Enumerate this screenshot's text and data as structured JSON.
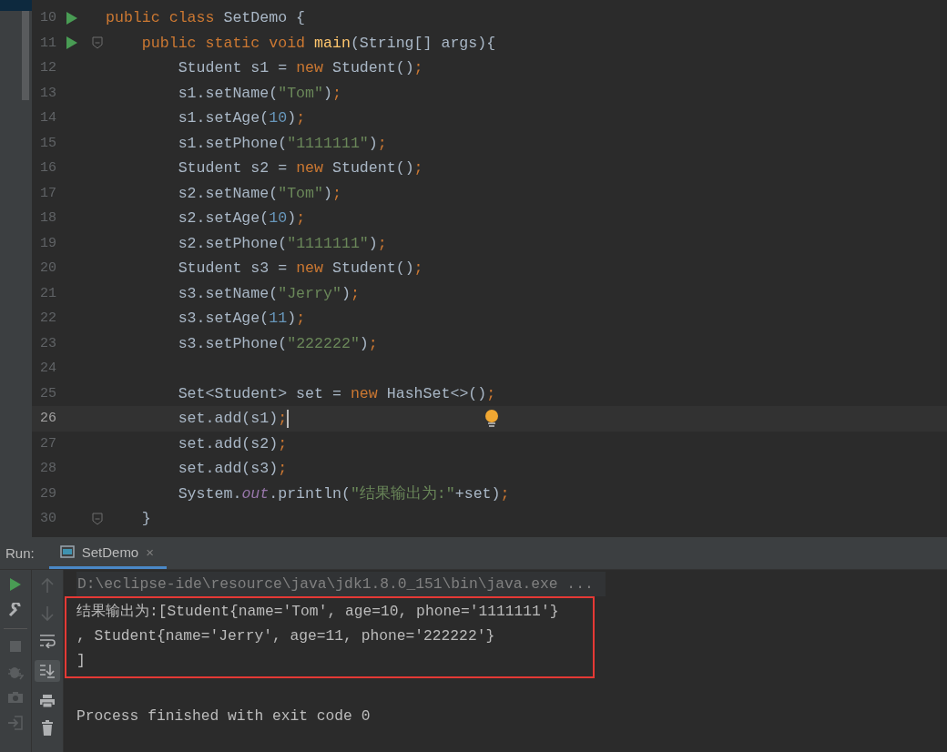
{
  "editor": {
    "lines": [
      {
        "number": "10",
        "run": true,
        "fold": false,
        "current": false,
        "hint": false,
        "tokens": [
          {
            "text": "public class ",
            "kind": "kw"
          },
          {
            "text": "SetDemo {",
            "kind": "plain"
          }
        ]
      },
      {
        "number": "11",
        "run": true,
        "fold": true,
        "current": false,
        "hint": false,
        "tokens": [
          {
            "text": "    public static void ",
            "kind": "kw"
          },
          {
            "text": "main",
            "kind": "method"
          },
          {
            "text": "(String[] args){",
            "kind": "plain"
          }
        ]
      },
      {
        "number": "12",
        "run": false,
        "fold": false,
        "current": false,
        "hint": false,
        "tokens": [
          {
            "text": "        Student s1 = ",
            "kind": "plain"
          },
          {
            "text": "new ",
            "kind": "kw"
          },
          {
            "text": "Student()",
            "kind": "plain"
          },
          {
            "text": ";",
            "kind": "kw"
          }
        ]
      },
      {
        "number": "13",
        "run": false,
        "fold": false,
        "current": false,
        "hint": false,
        "tokens": [
          {
            "text": "        s1.setName(",
            "kind": "plain"
          },
          {
            "text": "\"Tom\"",
            "kind": "str"
          },
          {
            "text": ")",
            "kind": "plain"
          },
          {
            "text": ";",
            "kind": "kw"
          }
        ]
      },
      {
        "number": "14",
        "run": false,
        "fold": false,
        "current": false,
        "hint": false,
        "tokens": [
          {
            "text": "        s1.setAge(",
            "kind": "plain"
          },
          {
            "text": "10",
            "kind": "num"
          },
          {
            "text": ")",
            "kind": "plain"
          },
          {
            "text": ";",
            "kind": "kw"
          }
        ]
      },
      {
        "number": "15",
        "run": false,
        "fold": false,
        "current": false,
        "hint": false,
        "tokens": [
          {
            "text": "        s1.setPhone(",
            "kind": "plain"
          },
          {
            "text": "\"1111111\"",
            "kind": "str"
          },
          {
            "text": ")",
            "kind": "plain"
          },
          {
            "text": ";",
            "kind": "kw"
          }
        ]
      },
      {
        "number": "16",
        "run": false,
        "fold": false,
        "current": false,
        "hint": false,
        "tokens": [
          {
            "text": "        Student s2 = ",
            "kind": "plain"
          },
          {
            "text": "new ",
            "kind": "kw"
          },
          {
            "text": "Student()",
            "kind": "plain"
          },
          {
            "text": ";",
            "kind": "kw"
          }
        ]
      },
      {
        "number": "17",
        "run": false,
        "fold": false,
        "current": false,
        "hint": false,
        "tokens": [
          {
            "text": "        s2.setName(",
            "kind": "plain"
          },
          {
            "text": "\"Tom\"",
            "kind": "str"
          },
          {
            "text": ")",
            "kind": "plain"
          },
          {
            "text": ";",
            "kind": "kw"
          }
        ]
      },
      {
        "number": "18",
        "run": false,
        "fold": false,
        "current": false,
        "hint": false,
        "tokens": [
          {
            "text": "        s2.setAge(",
            "kind": "plain"
          },
          {
            "text": "10",
            "kind": "num"
          },
          {
            "text": ")",
            "kind": "plain"
          },
          {
            "text": ";",
            "kind": "kw"
          }
        ]
      },
      {
        "number": "19",
        "run": false,
        "fold": false,
        "current": false,
        "hint": false,
        "tokens": [
          {
            "text": "        s2.setPhone(",
            "kind": "plain"
          },
          {
            "text": "\"1111111\"",
            "kind": "str"
          },
          {
            "text": ")",
            "kind": "plain"
          },
          {
            "text": ";",
            "kind": "kw"
          }
        ]
      },
      {
        "number": "20",
        "run": false,
        "fold": false,
        "current": false,
        "hint": false,
        "tokens": [
          {
            "text": "        Student s3 = ",
            "kind": "plain"
          },
          {
            "text": "new ",
            "kind": "kw"
          },
          {
            "text": "Student()",
            "kind": "plain"
          },
          {
            "text": ";",
            "kind": "kw"
          }
        ]
      },
      {
        "number": "21",
        "run": false,
        "fold": false,
        "current": false,
        "hint": false,
        "tokens": [
          {
            "text": "        s3.setName(",
            "kind": "plain"
          },
          {
            "text": "\"Jerry\"",
            "kind": "str"
          },
          {
            "text": ")",
            "kind": "plain"
          },
          {
            "text": ";",
            "kind": "kw"
          }
        ]
      },
      {
        "number": "22",
        "run": false,
        "fold": false,
        "current": false,
        "hint": false,
        "tokens": [
          {
            "text": "        s3.setAge(",
            "kind": "plain"
          },
          {
            "text": "11",
            "kind": "num"
          },
          {
            "text": ")",
            "kind": "plain"
          },
          {
            "text": ";",
            "kind": "kw"
          }
        ]
      },
      {
        "number": "23",
        "run": false,
        "fold": false,
        "current": false,
        "hint": false,
        "tokens": [
          {
            "text": "        s3.setPhone(",
            "kind": "plain"
          },
          {
            "text": "\"222222\"",
            "kind": "str"
          },
          {
            "text": ")",
            "kind": "plain"
          },
          {
            "text": ";",
            "kind": "kw"
          }
        ]
      },
      {
        "number": "24",
        "run": false,
        "fold": false,
        "current": false,
        "hint": false
      },
      {
        "number": "25",
        "run": false,
        "fold": false,
        "current": false,
        "hint": false,
        "tokens": [
          {
            "text": "        Set<Student> set = ",
            "kind": "plain"
          },
          {
            "text": "new ",
            "kind": "kw"
          },
          {
            "text": "HashSet<>()",
            "kind": "plain"
          },
          {
            "text": ";",
            "kind": "kw"
          }
        ]
      },
      {
        "number": "26",
        "run": false,
        "fold": false,
        "current": true,
        "hint": true,
        "tokens": [
          {
            "text": "        set.add(s1)",
            "kind": "plain"
          },
          {
            "text": ";",
            "kind": "kw"
          }
        ]
      },
      {
        "number": "27",
        "run": false,
        "fold": false,
        "current": false,
        "hint": false,
        "tokens": [
          {
            "text": "        set.add(s2)",
            "kind": "plain"
          },
          {
            "text": ";",
            "kind": "kw"
          }
        ]
      },
      {
        "number": "28",
        "run": false,
        "fold": false,
        "current": false,
        "hint": false,
        "tokens": [
          {
            "text": "        set.add(s3)",
            "kind": "plain"
          },
          {
            "text": ";",
            "kind": "kw"
          }
        ]
      },
      {
        "number": "29",
        "run": false,
        "fold": false,
        "current": false,
        "hint": false,
        "tokens": [
          {
            "text": "        System.",
            "kind": "plain"
          },
          {
            "text": "out",
            "kind": "field"
          },
          {
            "text": ".println(",
            "kind": "plain"
          },
          {
            "text": "\"结果输出为:\"",
            "kind": "str"
          },
          {
            "text": "+set)",
            "kind": "plain"
          },
          {
            "text": ";",
            "kind": "kw"
          }
        ]
      },
      {
        "number": "30",
        "run": false,
        "fold": true,
        "current": false,
        "hint": false,
        "tokens": [
          {
            "text": "    }",
            "kind": "plain"
          }
        ]
      }
    ]
  },
  "run_panel": {
    "label": "Run:",
    "tabs": [
      {
        "label": "SetDemo",
        "selected": true,
        "close": "×"
      }
    ],
    "console": {
      "command": "D:\\eclipse-ide\\resource\\java\\jdk1.8.0_151\\bin\\java.exe ...",
      "marked_output": [
        "结果输出为:[Student{name='Tom', age=10, phone='1111111'}",
        ", Student{name='Jerry', age=11, phone='222222'}",
        "]"
      ],
      "exit_message": "Process finished with exit code 0"
    }
  }
}
